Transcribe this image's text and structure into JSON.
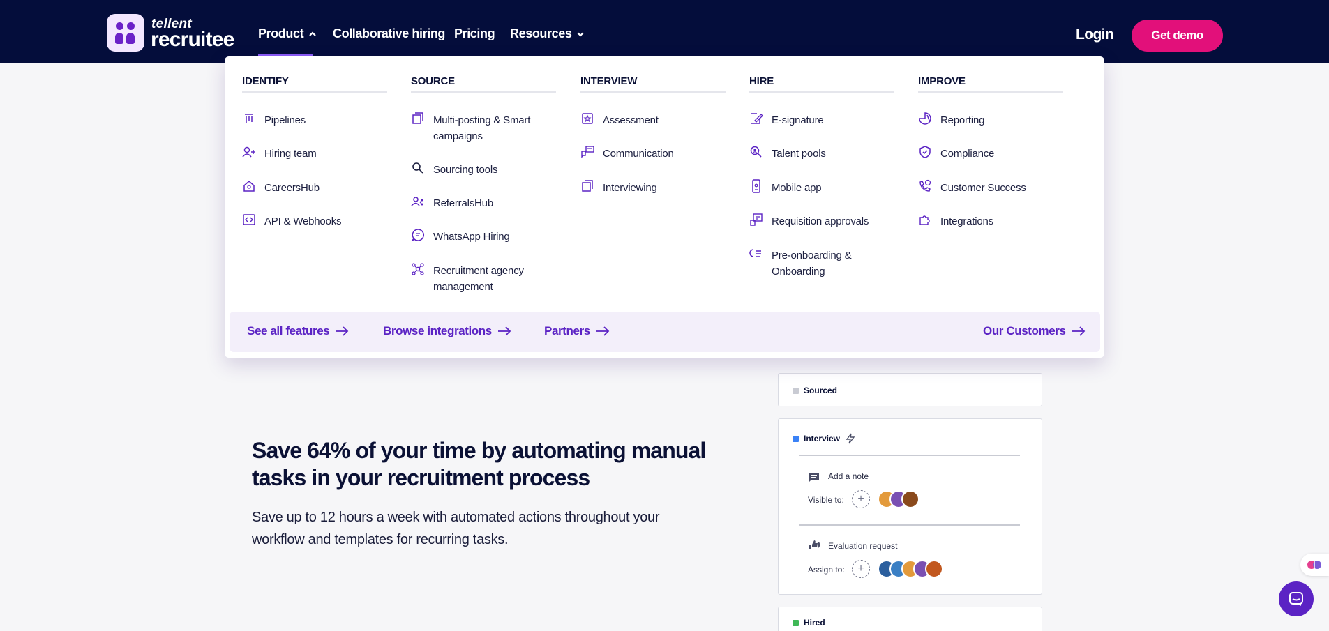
{
  "header": {
    "brand_small": "tellent",
    "brand_big": "recruitee",
    "nav": [
      {
        "label": "Product",
        "icon": "chevron-up-icon"
      },
      {
        "label": "Collaborative hiring"
      },
      {
        "label": "Pricing"
      },
      {
        "label": "Resources",
        "icon": "chevron-down-icon"
      }
    ],
    "login": "Login",
    "demo": "Get demo",
    "colors": {
      "bg": "#040d3b",
      "accent": "#e2107a",
      "underline": "#8b5cf6"
    }
  },
  "dropdown": {
    "columns": [
      {
        "heading": "IDENTIFY",
        "items": [
          {
            "label": "Pipelines",
            "icon": "pipelines-icon"
          },
          {
            "label": "Hiring team",
            "icon": "add-person-icon"
          },
          {
            "label": "CareersHub",
            "icon": "careers-home-icon"
          },
          {
            "label": "API & Webhooks",
            "icon": "code-icon"
          }
        ]
      },
      {
        "heading": "SOURCE",
        "items": [
          {
            "label": "Multi-posting & Smart campaigns",
            "icon": "copy-icon"
          },
          {
            "label": "Sourcing tools",
            "icon": "search-icon"
          },
          {
            "label": "ReferralsHub",
            "icon": "referral-icon"
          },
          {
            "label": "WhatsApp Hiring",
            "icon": "chat-icon"
          },
          {
            "label": "Recruitment agency management",
            "icon": "network-icon"
          }
        ]
      },
      {
        "heading": "INTERVIEW",
        "items": [
          {
            "label": "Assessment",
            "icon": "star-box-icon"
          },
          {
            "label": "Communication",
            "icon": "message-icon"
          },
          {
            "label": "Interviewing",
            "icon": "copy-icon"
          }
        ]
      },
      {
        "heading": "HIRE",
        "items": [
          {
            "label": "E-signature",
            "icon": "sign-icon"
          },
          {
            "label": "Talent pools",
            "icon": "search-person-icon"
          },
          {
            "label": "Mobile app",
            "icon": "mobile-icon"
          },
          {
            "label": "Requisition approvals",
            "icon": "approval-icon"
          },
          {
            "label": "Pre-onboarding & Onboarding",
            "icon": "checklist-icon"
          }
        ]
      },
      {
        "heading": "IMPROVE",
        "items": [
          {
            "label": "Reporting",
            "icon": "pie-chart-icon"
          },
          {
            "label": "Compliance",
            "icon": "shield-check-icon"
          },
          {
            "label": "Customer Success",
            "icon": "phone-support-icon"
          },
          {
            "label": "Integrations",
            "icon": "puzzle-icon"
          }
        ]
      }
    ],
    "footer_links": [
      {
        "label": "See all features"
      },
      {
        "label": "Browse integrations"
      },
      {
        "label": "Partners"
      },
      {
        "label": "Our Customers"
      }
    ]
  },
  "main": {
    "headline": "Save 64% of your time by automating manual tasks in your recruitment process",
    "subtext": "Save up to 12 hours a week with automated actions throughout your workflow and templates for recurring tasks."
  },
  "pipeline": {
    "sourced": "Sourced",
    "interview": "Interview",
    "add_note": "Add a note",
    "visible_to": "Visible to:",
    "evaluation_request": "Evaluation request",
    "assign_to": "Assign to:",
    "hired": "Hired",
    "colors": {
      "sourced": "#c9cbd3",
      "interview": "#3b82f6",
      "hired": "#3fb857"
    }
  }
}
